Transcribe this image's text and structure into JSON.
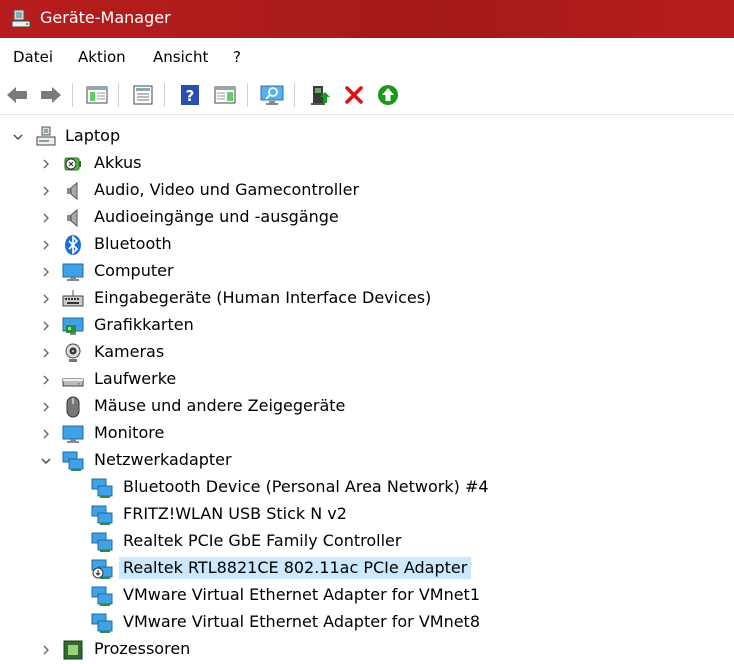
{
  "window": {
    "title": "Geräte-Manager"
  },
  "menu": {
    "items": [
      "Datei",
      "Aktion",
      "Ansicht",
      "?"
    ]
  },
  "toolbar": {
    "buttons": [
      "back-icon",
      "forward-icon",
      "show-hide-console-tree-icon",
      "properties-icon",
      "help-icon",
      "action-pane-icon",
      "scan-hardware-icon",
      "update-driver-icon",
      "uninstall-icon",
      "enable-device-icon"
    ]
  },
  "tree": {
    "root": "Laptop",
    "categories": [
      "Akkus",
      "Audio, Video und Gamecontroller",
      "Audioeingänge und -ausgänge",
      "Bluetooth",
      "Computer",
      "Eingabegeräte (Human Interface Devices)",
      "Grafikkarten",
      "Kameras",
      "Laufwerke",
      "Mäuse und andere Zeigegeräte",
      "Monitore",
      "Netzwerkadapter"
    ],
    "network_adapters": [
      "Bluetooth Device (Personal Area Network) #4",
      "FRITZ!WLAN USB Stick N v2",
      "Realtek PCIe GbE Family Controller",
      "Realtek RTL8821CE 802.11ac PCIe Adapter",
      "VMware Virtual Ethernet Adapter for VMnet1",
      "VMware Virtual Ethernet Adapter for VMnet8"
    ],
    "after": [
      "Prozessoren"
    ],
    "selected": "Realtek RTL8821CE 802.11ac PCIe Adapter"
  },
  "colors": {
    "titlebar": "#b71c1c",
    "selection": "#cce8ff",
    "uninstall": "#e01010",
    "enable": "#1a9a1a"
  }
}
